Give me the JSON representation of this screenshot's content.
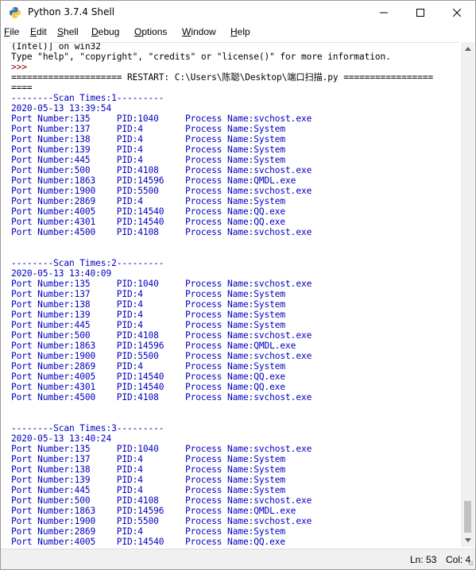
{
  "window": {
    "title": "Python 3.7.4 Shell",
    "icon": "python-icon",
    "controls": {
      "minimize": "minimize-icon",
      "maximize": "maximize-icon",
      "close": "close-icon"
    }
  },
  "menu": {
    "items": [
      {
        "label": "File",
        "mnemonic": "F"
      },
      {
        "label": "Edit",
        "mnemonic": "E"
      },
      {
        "label": "Shell",
        "mnemonic": "S"
      },
      {
        "label": "Debug",
        "mnemonic": "D"
      },
      {
        "label": "Options",
        "mnemonic": "O"
      },
      {
        "label": "Window",
        "mnemonic": "W"
      },
      {
        "label": "Help",
        "mnemonic": "H"
      }
    ]
  },
  "shell": {
    "lines": [
      {
        "text": "(Intel)] on win32",
        "kind": "plain"
      },
      {
        "text": "Type \"help\", \"copyright\", \"credits\" or \"license()\" for more information.",
        "kind": "plain"
      },
      {
        "text": ">>>",
        "kind": "prompt"
      },
      {
        "text": "===================== RESTART: C:\\Users\\陈聪\\Desktop\\端口扫描.py =================",
        "kind": "plain"
      },
      {
        "text": "====",
        "kind": "plain"
      },
      {
        "text": "--------Scan Times:1---------",
        "kind": "stdout"
      },
      {
        "text": "2020-05-13 13:39:54",
        "kind": "stdout"
      },
      {
        "text": "Port Number:135     PID:1040     Process Name:svchost.exe",
        "kind": "stdout"
      },
      {
        "text": "Port Number:137     PID:4        Process Name:System",
        "kind": "stdout"
      },
      {
        "text": "Port Number:138     PID:4        Process Name:System",
        "kind": "stdout"
      },
      {
        "text": "Port Number:139     PID:4        Process Name:System",
        "kind": "stdout"
      },
      {
        "text": "Port Number:445     PID:4        Process Name:System",
        "kind": "stdout"
      },
      {
        "text": "Port Number:500     PID:4108     Process Name:svchost.exe",
        "kind": "stdout"
      },
      {
        "text": "Port Number:1863    PID:14596    Process Name:QMDL.exe",
        "kind": "stdout"
      },
      {
        "text": "Port Number:1900    PID:5500     Process Name:svchost.exe",
        "kind": "stdout"
      },
      {
        "text": "Port Number:2869    PID:4        Process Name:System",
        "kind": "stdout"
      },
      {
        "text": "Port Number:4005    PID:14540    Process Name:QQ.exe",
        "kind": "stdout"
      },
      {
        "text": "Port Number:4301    PID:14540    Process Name:QQ.exe",
        "kind": "stdout"
      },
      {
        "text": "Port Number:4500    PID:4108     Process Name:svchost.exe",
        "kind": "stdout"
      },
      {
        "text": "",
        "kind": "stdout"
      },
      {
        "text": "",
        "kind": "stdout"
      },
      {
        "text": "--------Scan Times:2---------",
        "kind": "stdout"
      },
      {
        "text": "2020-05-13 13:40:09",
        "kind": "stdout"
      },
      {
        "text": "Port Number:135     PID:1040     Process Name:svchost.exe",
        "kind": "stdout"
      },
      {
        "text": "Port Number:137     PID:4        Process Name:System",
        "kind": "stdout"
      },
      {
        "text": "Port Number:138     PID:4        Process Name:System",
        "kind": "stdout"
      },
      {
        "text": "Port Number:139     PID:4        Process Name:System",
        "kind": "stdout"
      },
      {
        "text": "Port Number:445     PID:4        Process Name:System",
        "kind": "stdout"
      },
      {
        "text": "Port Number:500     PID:4108     Process Name:svchost.exe",
        "kind": "stdout"
      },
      {
        "text": "Port Number:1863    PID:14596    Process Name:QMDL.exe",
        "kind": "stdout"
      },
      {
        "text": "Port Number:1900    PID:5500     Process Name:svchost.exe",
        "kind": "stdout"
      },
      {
        "text": "Port Number:2869    PID:4        Process Name:System",
        "kind": "stdout"
      },
      {
        "text": "Port Number:4005    PID:14540    Process Name:QQ.exe",
        "kind": "stdout"
      },
      {
        "text": "Port Number:4301    PID:14540    Process Name:QQ.exe",
        "kind": "stdout"
      },
      {
        "text": "Port Number:4500    PID:4108     Process Name:svchost.exe",
        "kind": "stdout"
      },
      {
        "text": "",
        "kind": "stdout"
      },
      {
        "text": "",
        "kind": "stdout"
      },
      {
        "text": "--------Scan Times:3---------",
        "kind": "stdout"
      },
      {
        "text": "2020-05-13 13:40:24",
        "kind": "stdout"
      },
      {
        "text": "Port Number:135     PID:1040     Process Name:svchost.exe",
        "kind": "stdout"
      },
      {
        "text": "Port Number:137     PID:4        Process Name:System",
        "kind": "stdout"
      },
      {
        "text": "Port Number:138     PID:4        Process Name:System",
        "kind": "stdout"
      },
      {
        "text": "Port Number:139     PID:4        Process Name:System",
        "kind": "stdout"
      },
      {
        "text": "Port Number:445     PID:4        Process Name:System",
        "kind": "stdout"
      },
      {
        "text": "Port Number:500     PID:4108     Process Name:svchost.exe",
        "kind": "stdout"
      },
      {
        "text": "Port Number:1863    PID:14596    Process Name:QMDL.exe",
        "kind": "stdout"
      },
      {
        "text": "Port Number:1900    PID:5500     Process Name:svchost.exe",
        "kind": "stdout"
      },
      {
        "text": "Port Number:2869    PID:4        Process Name:System",
        "kind": "stdout"
      },
      {
        "text": "Port Number:4005    PID:14540    Process Name:QQ.exe",
        "kind": "stdout"
      }
    ],
    "colors": {
      "stdout": "#0000c0",
      "prompt": "#8b0000",
      "plain": "#000000"
    }
  },
  "status": {
    "ln": "Ln: 53",
    "col": "Col: 4"
  },
  "scrollbar": {
    "up_icon": "scroll-up-icon",
    "down_icon": "scroll-down-icon"
  }
}
